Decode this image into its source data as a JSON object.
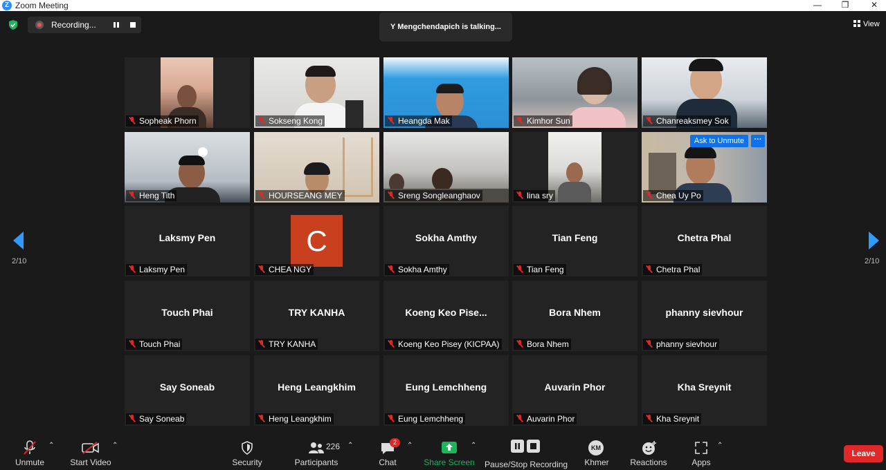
{
  "window": {
    "title": "Zoom Meeting",
    "logo": "Z"
  },
  "topbar": {
    "recording_label": "Recording...",
    "talking_text": "Y Mengchendapich is talking...",
    "view_label": "View"
  },
  "pagination": {
    "left_page": "2/10",
    "right_page": "2/10"
  },
  "tiles": [
    {
      "label": "Sopheak Phorn",
      "display": ""
    },
    {
      "label": "Sokseng Kong",
      "display": ""
    },
    {
      "label": "Heangda Mak",
      "display": ""
    },
    {
      "label": "Kimhor Sun",
      "display": ""
    },
    {
      "label": "Chanreaksmey Sok",
      "display": ""
    },
    {
      "label": "Heng Tith",
      "display": ""
    },
    {
      "label": "HOURSEANG MEY",
      "display": ""
    },
    {
      "label": "Sreng Songleanghaov",
      "display": ""
    },
    {
      "label": "lina sry",
      "display": ""
    },
    {
      "label": "Chea Uy Po",
      "display": "",
      "ask_unmute": "Ask to Unmute",
      "more": "···"
    },
    {
      "label": "Laksmy Pen",
      "display": "Laksmy Pen"
    },
    {
      "label": "CHEA NGY",
      "display": "",
      "avatar_letter": "C"
    },
    {
      "label": "Sokha Amthy",
      "display": "Sokha Amthy"
    },
    {
      "label": "Tian Feng",
      "display": "Tian Feng"
    },
    {
      "label": "Chetra Phal",
      "display": "Chetra Phal"
    },
    {
      "label": "Touch Phai",
      "display": "Touch Phai"
    },
    {
      "label": "TRY KANHA",
      "display": "TRY KANHA"
    },
    {
      "label": "Koeng Keo Pisey (KICPAA)",
      "display": "Koeng  Keo  Pise..."
    },
    {
      "label": "Bora Nhem",
      "display": "Bora Nhem"
    },
    {
      "label": "phanny sievhour",
      "display": "phanny sievhour"
    },
    {
      "label": "Say Soneab",
      "display": "Say Soneab"
    },
    {
      "label": "Heng Leangkhim",
      "display": "Heng Leangkhim"
    },
    {
      "label": "Eung Lemchheng",
      "display": "Eung Lemchheng"
    },
    {
      "label": "Auvarin Phor",
      "display": "Auvarin Phor"
    },
    {
      "label": "Kha Sreynit",
      "display": "Kha Sreynit"
    }
  ],
  "toolbar": {
    "unmute": "Unmute",
    "start_video": "Start Video",
    "security": "Security",
    "participants": "Participants",
    "participants_count": "226",
    "chat": "Chat",
    "chat_badge": "2",
    "share_screen": "Share Screen",
    "recording": "Pause/Stop Recording",
    "language": "Khmer",
    "language_badge": "KM",
    "reactions": "Reactions",
    "apps": "Apps",
    "leave": "Leave"
  },
  "colors": {
    "accent": "#2d9cff",
    "share_green": "#1bb55c",
    "leave_red": "#e02828",
    "avatar_orange": "#c8401d"
  }
}
